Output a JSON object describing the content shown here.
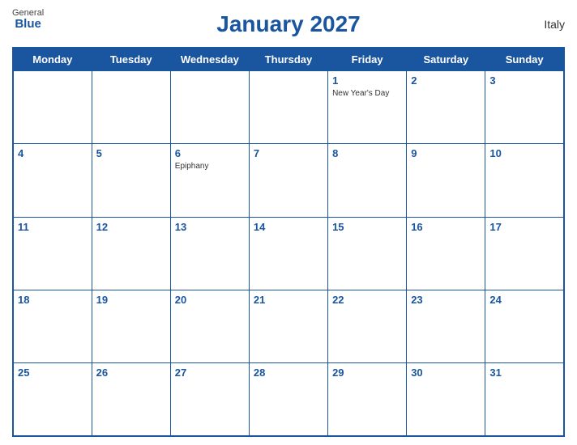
{
  "header": {
    "title": "January 2027",
    "country": "Italy",
    "logo": {
      "general": "General",
      "blue": "Blue"
    }
  },
  "days_of_week": [
    "Monday",
    "Tuesday",
    "Wednesday",
    "Thursday",
    "Friday",
    "Saturday",
    "Sunday"
  ],
  "weeks": [
    [
      {
        "day": "",
        "holiday": ""
      },
      {
        "day": "",
        "holiday": ""
      },
      {
        "day": "",
        "holiday": ""
      },
      {
        "day": "",
        "holiday": ""
      },
      {
        "day": "1",
        "holiday": "New Year's Day"
      },
      {
        "day": "2",
        "holiday": ""
      },
      {
        "day": "3",
        "holiday": ""
      }
    ],
    [
      {
        "day": "4",
        "holiday": ""
      },
      {
        "day": "5",
        "holiday": ""
      },
      {
        "day": "6",
        "holiday": "Epiphany"
      },
      {
        "day": "7",
        "holiday": ""
      },
      {
        "day": "8",
        "holiday": ""
      },
      {
        "day": "9",
        "holiday": ""
      },
      {
        "day": "10",
        "holiday": ""
      }
    ],
    [
      {
        "day": "11",
        "holiday": ""
      },
      {
        "day": "12",
        "holiday": ""
      },
      {
        "day": "13",
        "holiday": ""
      },
      {
        "day": "14",
        "holiday": ""
      },
      {
        "day": "15",
        "holiday": ""
      },
      {
        "day": "16",
        "holiday": ""
      },
      {
        "day": "17",
        "holiday": ""
      }
    ],
    [
      {
        "day": "18",
        "holiday": ""
      },
      {
        "day": "19",
        "holiday": ""
      },
      {
        "day": "20",
        "holiday": ""
      },
      {
        "day": "21",
        "holiday": ""
      },
      {
        "day": "22",
        "holiday": ""
      },
      {
        "day": "23",
        "holiday": ""
      },
      {
        "day": "24",
        "holiday": ""
      }
    ],
    [
      {
        "day": "25",
        "holiday": ""
      },
      {
        "day": "26",
        "holiday": ""
      },
      {
        "day": "27",
        "holiday": ""
      },
      {
        "day": "28",
        "holiday": ""
      },
      {
        "day": "29",
        "holiday": ""
      },
      {
        "day": "30",
        "holiday": ""
      },
      {
        "day": "31",
        "holiday": ""
      }
    ]
  ]
}
